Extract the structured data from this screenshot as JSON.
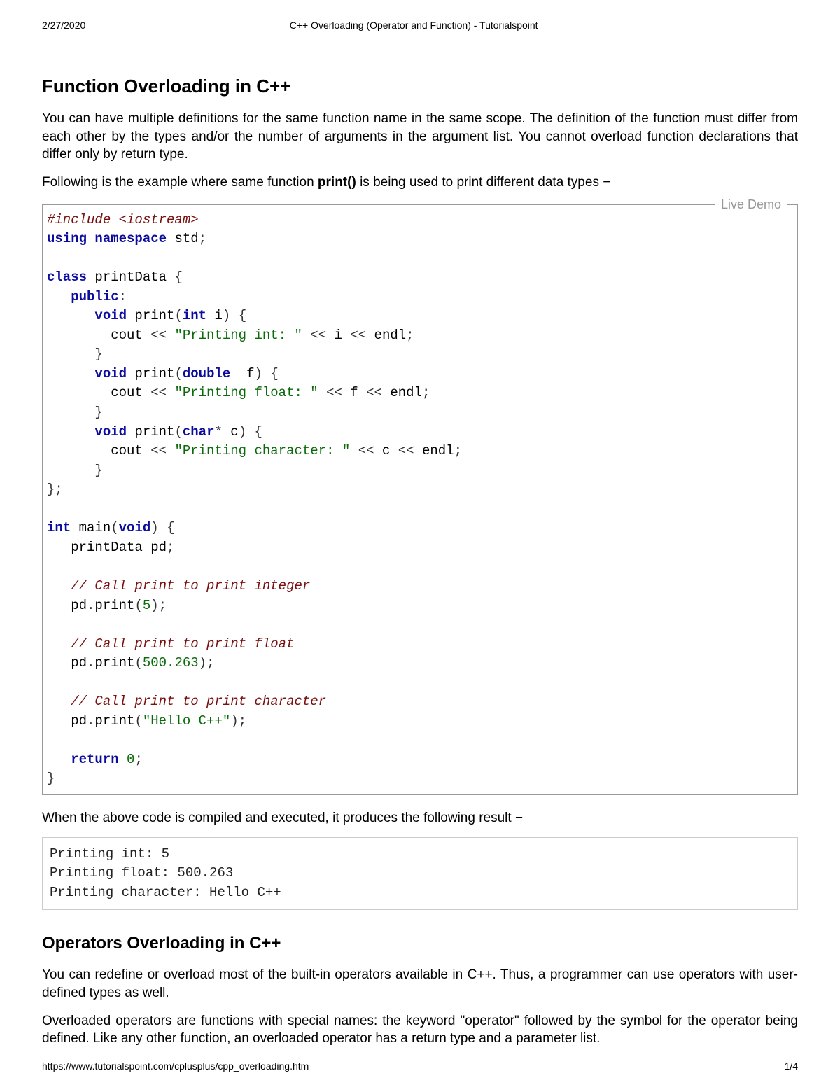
{
  "header": {
    "date": "2/27/2020",
    "title": "C++ Overloading (Operator and Function) - Tutorialspoint"
  },
  "section1": {
    "heading": "Function Overloading in C++",
    "para1": "You can have multiple definitions for the same function name in the same scope. The definition of the function must differ from each other by the types and/or the number of arguments in the argument list. You cannot overload function declarations that differ only by return type.",
    "para2_pre": "Following is the example where same function ",
    "para2_bold": "print()",
    "para2_post": " is being used to print different data types −"
  },
  "live_demo_label": "Live Demo",
  "code": {
    "l01a": "#include",
    "l01b": " <iostream>",
    "l02a": "using",
    "l02b": " ",
    "l02c": "namespace",
    "l02d": " std",
    "l02e": ";",
    "l03": "",
    "l04a": "class",
    "l04b": " printData ",
    "l04c": "{",
    "l05a": "   ",
    "l05b": "public",
    "l05c": ":",
    "l06a": "      ",
    "l06b": "void",
    "l06c": " print",
    "l06d": "(",
    "l06e": "int",
    "l06f": " i",
    "l06g": ")",
    "l06h": " ",
    "l06i": "{",
    "l07a": "        cout ",
    "l07b": "<<",
    "l07c": " ",
    "l07d": "\"Printing int: \"",
    "l07e": " ",
    "l07f": "<<",
    "l07g": " i ",
    "l07h": "<<",
    "l07i": " endl",
    "l07j": ";",
    "l08a": "      ",
    "l08b": "}",
    "l09a": "      ",
    "l09b": "void",
    "l09c": " print",
    "l09d": "(",
    "l09e": "double",
    "l09f": "  f",
    "l09g": ")",
    "l09h": " ",
    "l09i": "{",
    "l10a": "        cout ",
    "l10b": "<<",
    "l10c": " ",
    "l10d": "\"Printing float: \"",
    "l10e": " ",
    "l10f": "<<",
    "l10g": " f ",
    "l10h": "<<",
    "l10i": " endl",
    "l10j": ";",
    "l11a": "      ",
    "l11b": "}",
    "l12a": "      ",
    "l12b": "void",
    "l12c": " print",
    "l12d": "(",
    "l12e": "char",
    "l12f": "*",
    "l12g": " c",
    "l12h": ")",
    "l12i": " ",
    "l12j": "{",
    "l13a": "        cout ",
    "l13b": "<<",
    "l13c": " ",
    "l13d": "\"Printing character: \"",
    "l13e": " ",
    "l13f": "<<",
    "l13g": " c ",
    "l13h": "<<",
    "l13i": " endl",
    "l13j": ";",
    "l14a": "      ",
    "l14b": "}",
    "l15a": "};",
    "l16": "",
    "l17a": "int",
    "l17b": " main",
    "l17c": "(",
    "l17d": "void",
    "l17e": ")",
    "l17f": " ",
    "l17g": "{",
    "l18a": "   printData pd",
    "l18b": ";",
    "l19": "",
    "l20a": "   ",
    "l20b": "// Call print to print integer",
    "l21a": "   pd",
    "l21b": ".",
    "l21c": "print",
    "l21d": "(",
    "l21e": "5",
    "l21f": ");",
    "l22": "",
    "l23a": "   ",
    "l23b": "// Call print to print float",
    "l24a": "   pd",
    "l24b": ".",
    "l24c": "print",
    "l24d": "(",
    "l24e": "500.263",
    "l24f": ");",
    "l25": "",
    "l26a": "   ",
    "l26b": "// Call print to print character",
    "l27a": "   pd",
    "l27b": ".",
    "l27c": "print",
    "l27d": "(",
    "l27e": "\"Hello C++\"",
    "l27f": ");",
    "l28": "",
    "l29a": "   ",
    "l29b": "return",
    "l29c": " ",
    "l29d": "0",
    "l29e": ";",
    "l30a": "}"
  },
  "result_intro": "When the above code is compiled and executed, it produces the following result −",
  "output": "Printing int: 5\nPrinting float: 500.263\nPrinting character: Hello C++",
  "section2": {
    "heading": "Operators Overloading in C++",
    "para1": "You can redefine or overload most of the built-in operators available in C++. Thus, a programmer can use operators with user-defined types as well.",
    "para2": "Overloaded operators are functions with special names: the keyword \"operator\" followed by the symbol for the operator being defined. Like any other function, an overloaded operator has a return type and a parameter list."
  },
  "footer": {
    "url": "https://www.tutorialspoint.com/cplusplus/cpp_overloading.htm",
    "page": "1/4"
  }
}
